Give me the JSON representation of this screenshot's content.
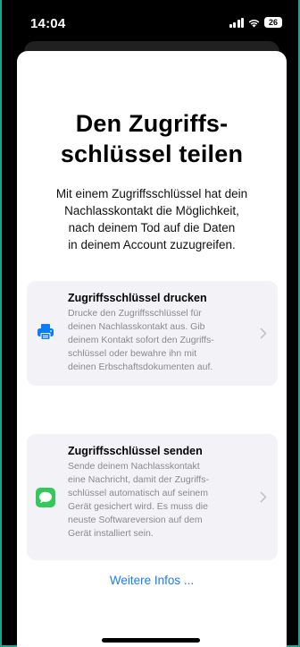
{
  "status_bar": {
    "time": "14:04",
    "battery_level": "26"
  },
  "page": {
    "title_lines": [
      "Den Zugriffs-",
      "schlüssel teilen"
    ],
    "description_lines": [
      "Mit einem Zugriffsschlüssel hat dein",
      "Nachlasskontakt die Möglichkeit,",
      "nach deinem Tod auf die Daten",
      "in deinem Account zuzugreifen."
    ]
  },
  "options": [
    {
      "title": "Zugriffsschlüssel drucken",
      "body_lines": [
        "Drucke den Zugriffsschlüssel für",
        "deinen Nachlasskontakt aus. Gib",
        "deinem Kontakt sofort den Zugriffs-",
        "schlüssel oder bewahre ihn mit",
        "deinen Erbschaftsdokumenten auf."
      ],
      "icon": "printer-icon",
      "icon_color": "#0a7aff"
    },
    {
      "title": "Zugriffsschlüssel senden",
      "body_lines": [
        "Sende deinem Nachlasskontakt",
        "eine Nachricht, damit der Zugriffs-",
        "schlüssel automatisch auf seinem",
        "Gerät gesichert wird. Es muss die",
        "neuste Softwareversion auf dem",
        "Gerät installiert sein."
      ],
      "icon": "messages-icon",
      "icon_color": "#34c759"
    }
  ],
  "link": {
    "more_info": "Weitere Infos ..."
  },
  "colors": {
    "accent": "#1a7cf5",
    "card_background": "#f2f2f7",
    "secondary_text": "#8a8a8e"
  }
}
